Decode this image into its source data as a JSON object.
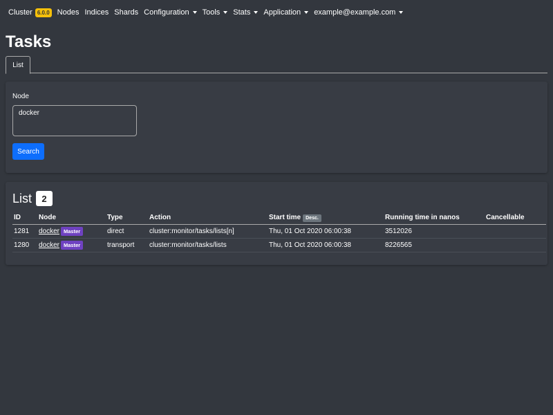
{
  "nav": {
    "brand": "Cluster",
    "version": "6.0.0",
    "items": [
      "Nodes",
      "Indices",
      "Shards"
    ],
    "dropdowns": [
      "Configuration",
      "Tools",
      "Stats",
      "Application",
      "example@example.com"
    ]
  },
  "page": {
    "title": "Tasks",
    "tab": "List"
  },
  "filter": {
    "node_label": "Node",
    "node_value": "docker",
    "search_label": "Search"
  },
  "list": {
    "title": "List",
    "count": "2",
    "sort_badge": "Desc.",
    "columns": [
      "ID",
      "Node",
      "Type",
      "Action",
      "Start time",
      "Running time in nanos",
      "Cancellable"
    ],
    "rows": [
      {
        "id": "1281",
        "node": "docker",
        "badge": "Master",
        "type": "direct",
        "action": "cluster:monitor/tasks/lists[n]",
        "start": "Thu, 01 Oct 2020 06:00:38",
        "running": "3512026",
        "cancellable": ""
      },
      {
        "id": "1280",
        "node": "docker",
        "badge": "Master",
        "type": "transport",
        "action": "cluster:monitor/tasks/lists",
        "start": "Thu, 01 Oct 2020 06:00:38",
        "running": "8226565",
        "cancellable": ""
      }
    ]
  }
}
